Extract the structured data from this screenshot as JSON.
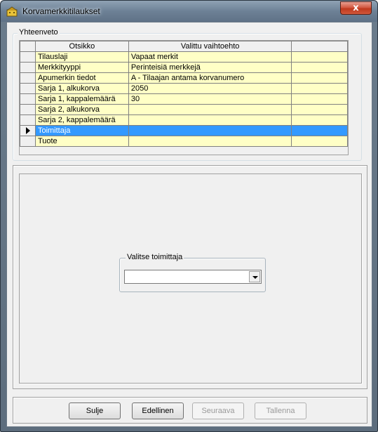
{
  "window": {
    "title": "Korvamerkkitilaukset",
    "close_label": "x"
  },
  "summary": {
    "legend": "Yhteenveto",
    "columns": [
      "Otsikko",
      "Valittu vaihtoehto",
      ""
    ],
    "rows": [
      {
        "label": "Tilauslaji",
        "value": "Vapaat merkit",
        "active": false
      },
      {
        "label": "Merkkityyppi",
        "value": "Perinteisiä merkkejä",
        "active": false
      },
      {
        "label": "Apumerkin tiedot",
        "value": "A - Tilaajan antama korvanumero",
        "active": false
      },
      {
        "label": "Sarja 1, alkukorva",
        "value": "2050",
        "active": false
      },
      {
        "label": "Sarja 1, kappalemäärä",
        "value": "30",
        "active": false
      },
      {
        "label": "Sarja 2, alkukorva",
        "value": "",
        "active": false
      },
      {
        "label": "Sarja 2, kappalemäärä",
        "value": "",
        "active": false
      },
      {
        "label": "Toimittaja",
        "value": "",
        "active": true
      },
      {
        "label": "Tuote",
        "value": "",
        "active": false
      }
    ]
  },
  "supplier": {
    "legend": "Valitse toimittaja",
    "selected": ""
  },
  "buttons": {
    "close": "Sulje",
    "previous": "Edellinen",
    "next": "Seuraava",
    "save": "Tallenna"
  },
  "colors": {
    "row_bg": "#ffffc6",
    "selection": "#3399ff"
  }
}
